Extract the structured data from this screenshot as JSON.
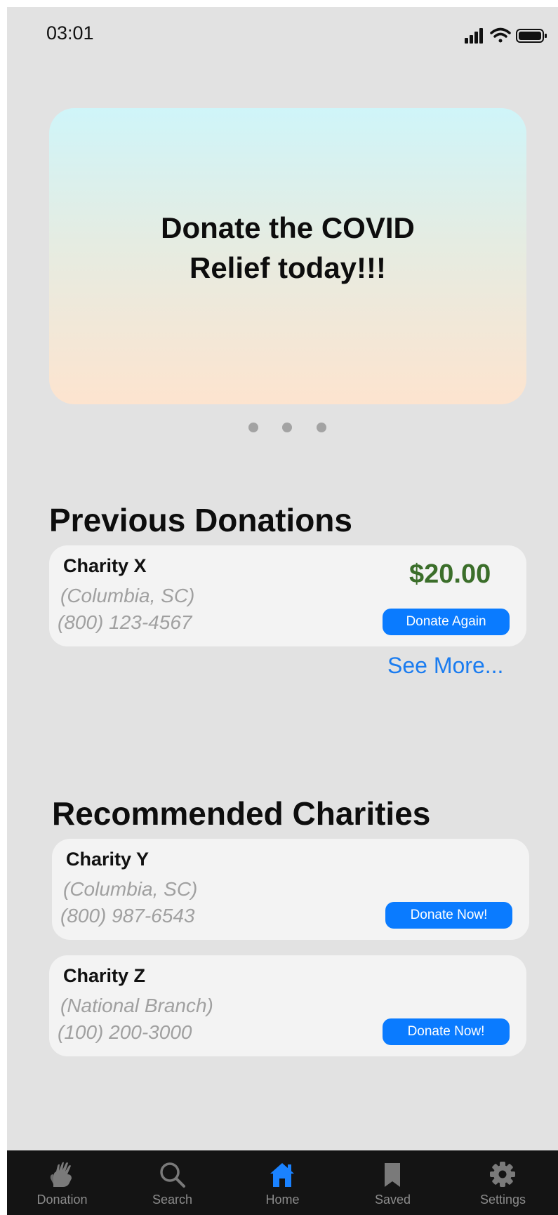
{
  "status_bar": {
    "time": "03:01"
  },
  "banner": {
    "text": "Donate the COVID\nRelief today!!!"
  },
  "previous": {
    "title": "Previous Donations",
    "card": {
      "name": "Charity X",
      "location": "(Columbia, SC)",
      "phone": "(800) 123-4567",
      "amount": "$20.00",
      "button": "Donate Again"
    },
    "see_more": "See More..."
  },
  "recommended": {
    "title": "Recommended Charities",
    "cards": [
      {
        "name": "Charity Y",
        "location": "(Columbia, SC)",
        "phone": "(800) 987-6543",
        "button": "Donate Now!"
      },
      {
        "name": "Charity Z",
        "location": "(National Branch)",
        "phone": "(100) 200-3000",
        "button": "Donate Now!"
      }
    ]
  },
  "tabs": [
    {
      "label": "Donation",
      "icon": "hands-icon"
    },
    {
      "label": "Search",
      "icon": "search-icon"
    },
    {
      "label": "Home",
      "icon": "home-icon"
    },
    {
      "label": "Saved",
      "icon": "bookmark-icon"
    },
    {
      "label": "Settings",
      "icon": "gear-icon"
    }
  ],
  "colors": {
    "accent": "#0a7bff",
    "amount": "#3b6e2a",
    "tab_active": "#1a82ff",
    "tab_inactive": "#7a7a7a"
  }
}
